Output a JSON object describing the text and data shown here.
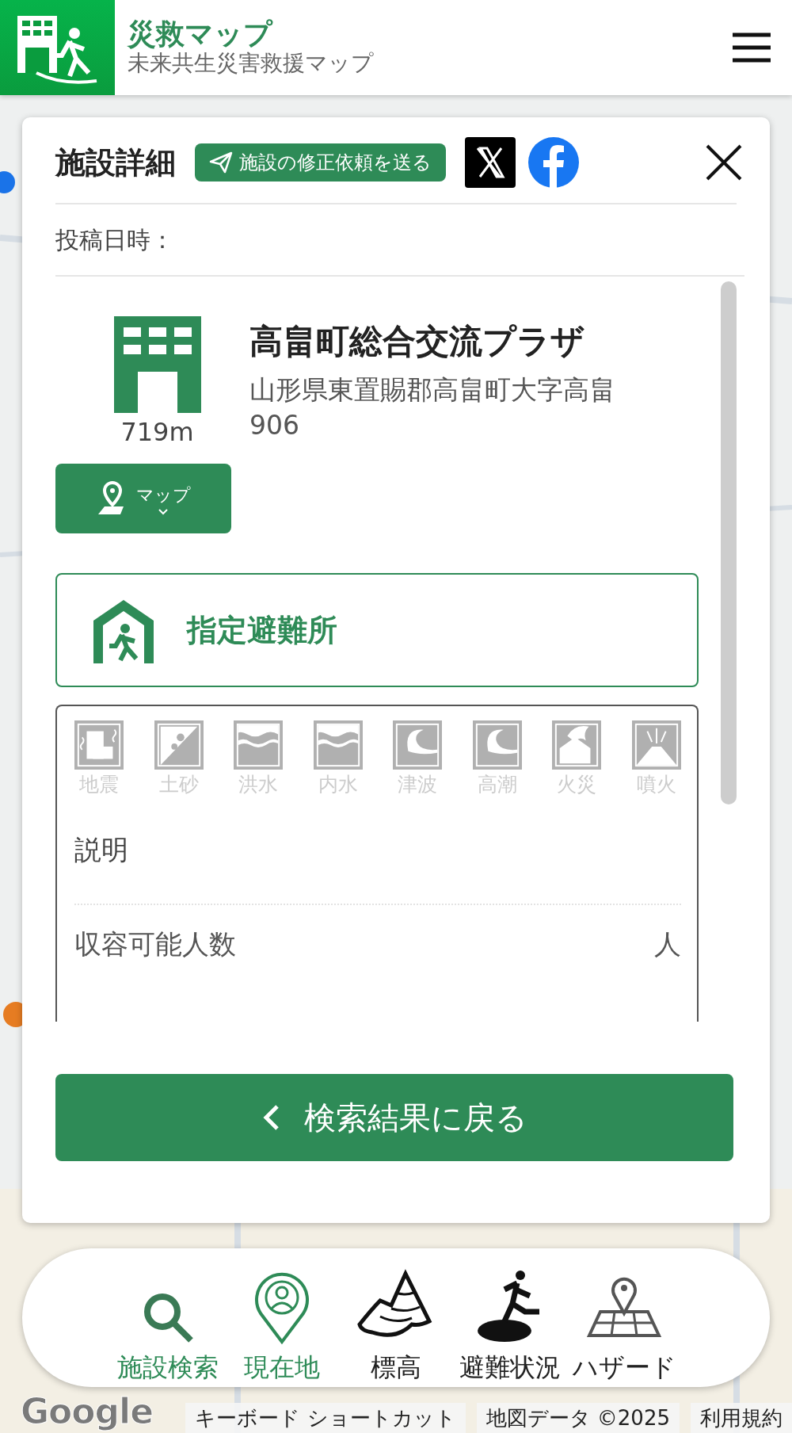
{
  "header": {
    "title": "災救マップ",
    "subtitle": "未来共生災害救援マップ"
  },
  "panel": {
    "title": "施設詳細",
    "report_button": "施設の修正依頼を送る",
    "posted_label": "投稿日時：",
    "facility": {
      "name": "高畠町総合交流プラザ",
      "address": "山形県東置賜郡高畠町大字高畠906",
      "distance": "719m",
      "map_button": "マップ"
    },
    "designation": "指定避難所",
    "hazards": [
      {
        "kind": "earthquake",
        "label": "地震",
        "active": false
      },
      {
        "kind": "landslide",
        "label": "土砂",
        "active": false
      },
      {
        "kind": "flood",
        "label": "洪水",
        "active": false
      },
      {
        "kind": "flood",
        "label": "内水",
        "active": false
      },
      {
        "kind": "tsunami",
        "label": "津波",
        "active": false
      },
      {
        "kind": "tsunami",
        "label": "高潮",
        "active": false
      },
      {
        "kind": "fire",
        "label": "火災",
        "active": false
      },
      {
        "kind": "volcano",
        "label": "噴火",
        "active": false
      }
    ],
    "description_label": "説明",
    "capacity": {
      "label": "収容可能人数",
      "unit": "人"
    },
    "back_button": "検索結果に戻る"
  },
  "bottom_nav": [
    {
      "kind": "search",
      "label": "施設検索",
      "selected": true
    },
    {
      "kind": "location",
      "label": "現在地",
      "selected": true
    },
    {
      "kind": "elevation",
      "label": "標高",
      "selected": false
    },
    {
      "kind": "evacuation",
      "label": "避難状況",
      "selected": false
    },
    {
      "kind": "hazard",
      "label": "ハザード",
      "selected": false
    }
  ],
  "map_footer": {
    "logo": "Google",
    "links": [
      "キーボード ショートカット",
      "地図データ ©2025",
      "利用規約"
    ]
  }
}
